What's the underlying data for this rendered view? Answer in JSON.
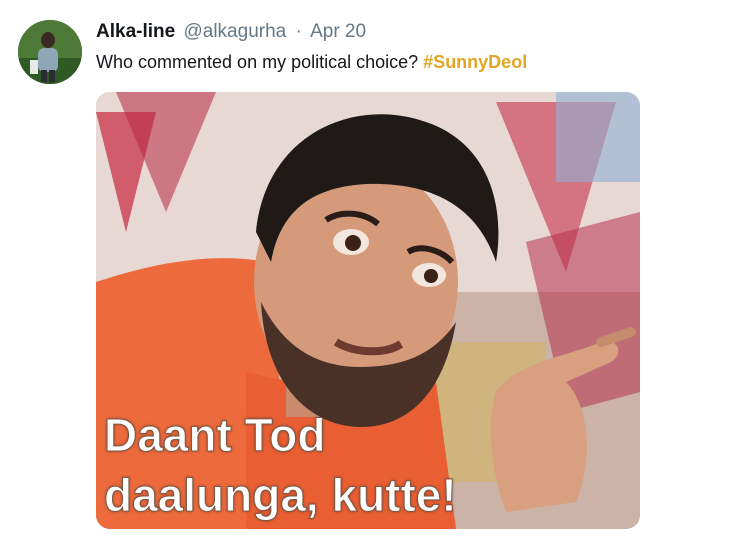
{
  "tweet": {
    "author": {
      "display_name": "Alka-line",
      "handle": "@alkagurha",
      "separator": "·",
      "date": "Apr 20"
    },
    "text": "Who commented on my political choice?",
    "hashtag": "#SunnyDeol",
    "media": {
      "caption_line1": "Daant Tod",
      "caption_line2": "daalunga, kutte!"
    }
  },
  "colors": {
    "hashtag": "#e2a524",
    "name": "#14171a",
    "muted": "#657786"
  }
}
